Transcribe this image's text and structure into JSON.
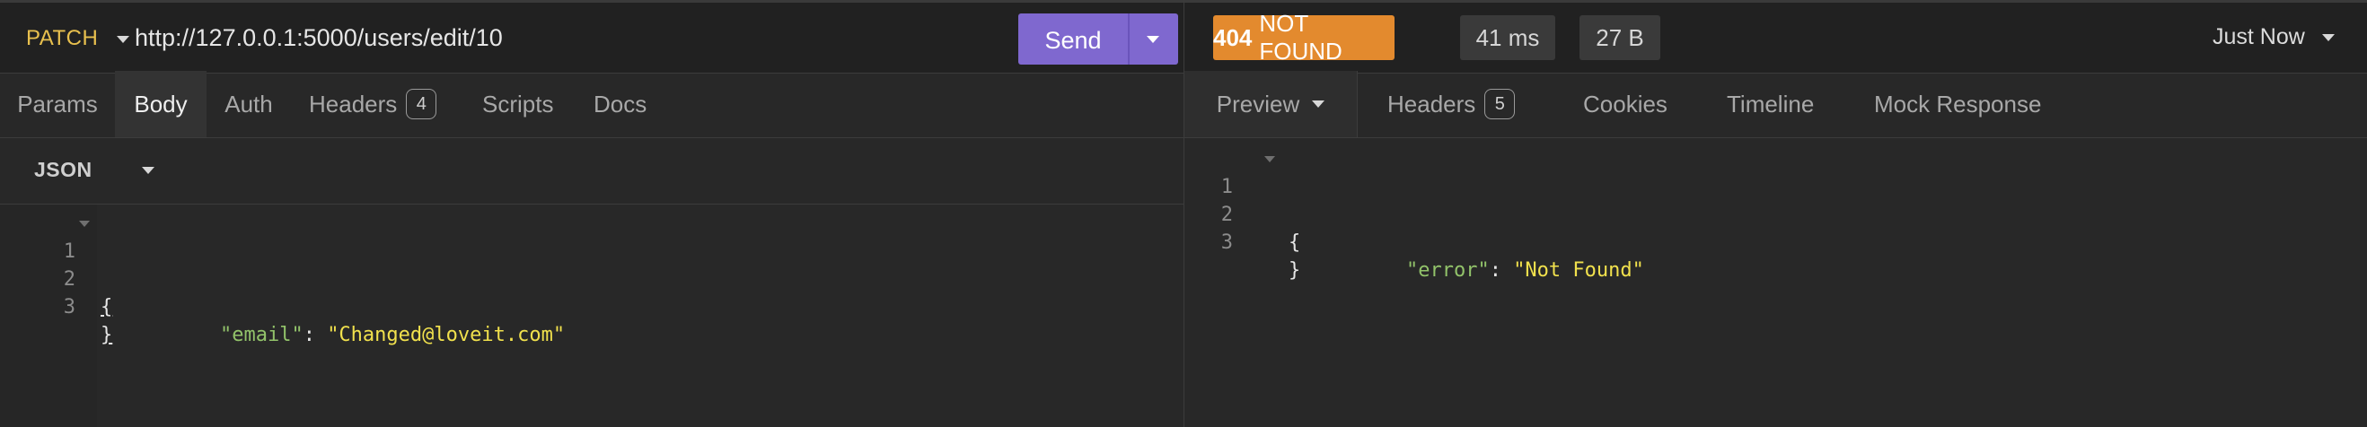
{
  "request": {
    "method": "PATCH",
    "url": "http://127.0.0.1:5000/users/edit/10",
    "send_label": "Send",
    "tabs": {
      "params": "Params",
      "body": "Body",
      "auth": "Auth",
      "headers": "Headers",
      "headers_count": "4",
      "scripts": "Scripts",
      "docs": "Docs"
    },
    "body_format": "JSON",
    "body_lines": [
      {
        "num": "1",
        "open": "{"
      },
      {
        "num": "2",
        "key": "\"email\"",
        "sep": ": ",
        "value": "\"Changed@loveit.com\""
      },
      {
        "num": "3",
        "close": "}"
      }
    ]
  },
  "response": {
    "status_code": "404",
    "status_text": "NOT FOUND",
    "time": "41 ms",
    "size": "27 B",
    "history": "Just Now",
    "tabs": {
      "preview": "Preview",
      "headers": "Headers",
      "headers_count": "5",
      "cookies": "Cookies",
      "timeline": "Timeline",
      "mock": "Mock Response"
    },
    "body_lines": [
      {
        "num": "1",
        "open": "{"
      },
      {
        "num": "2",
        "key": "\"error\"",
        "sep": ": ",
        "value": "\"Not Found\""
      },
      {
        "num": "3",
        "close": "}"
      }
    ]
  },
  "colors": {
    "send_button": "#7f68cf",
    "status_error": "#e38a2e",
    "method": "#e8c04e",
    "json_key": "#92c36a",
    "json_string": "#f1e14d"
  },
  "icons": [
    "chevron-down-icon",
    "fold-icon"
  ]
}
